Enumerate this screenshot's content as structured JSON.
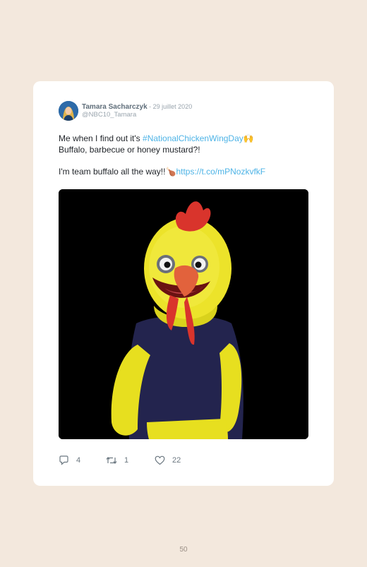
{
  "tweet": {
    "author_name": "Tamara Sacharczyk",
    "separator": " - ",
    "date": "29 juillet 2020",
    "handle": "@NBC10_Tamara",
    "line1_prefix": "Me when I find out it's ",
    "hashtag": "#NationalChickenWingDay",
    "line1_emoji": "🙌",
    "line2": "Buffalo, barbecue or honey mustard?!",
    "line3_text": "I'm team buffalo all the way!!",
    "line3_emoji": "🍗",
    "link": "https://t.co/mPNozkvfkF",
    "media_icon": "chicken-mascot-image"
  },
  "actions": {
    "reply_count": "4",
    "retweet_count": "1",
    "like_count": "22",
    "reply_icon": "reply-icon",
    "retweet_icon": "retweet-icon",
    "like_icon": "heart-icon"
  },
  "page": {
    "number": "50"
  },
  "colors": {
    "background": "#f3e8dd",
    "card": "#ffffff",
    "link": "#4db3e6"
  }
}
